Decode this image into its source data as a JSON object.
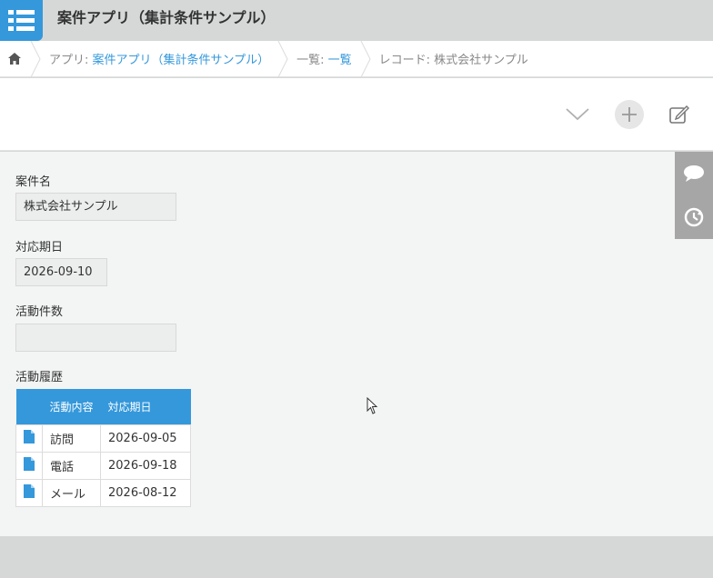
{
  "header": {
    "app_title": "案件アプリ（集計条件サンプル）"
  },
  "breadcrumb": {
    "app_prefix": "アプリ: ",
    "app_link": "案件アプリ（集計条件サンプル）",
    "list_prefix": "一覧: ",
    "list_link": "一覧",
    "record_label": "レコード: 株式会社サンプル"
  },
  "fields": {
    "case_name": {
      "label": "案件名",
      "value": "株式会社サンプル"
    },
    "due_date": {
      "label": "対応期日",
      "value": "2026-09-10"
    },
    "activity_count": {
      "label": "活動件数",
      "value": ""
    },
    "activity_history": {
      "label": "活動履歴"
    }
  },
  "subtable": {
    "headers": [
      "活動内容",
      "対応期日"
    ],
    "rows": [
      {
        "content": "訪問",
        "date": "2026-09-05"
      },
      {
        "content": "電話",
        "date": "2026-09-18"
      },
      {
        "content": "メール",
        "date": "2026-08-12"
      }
    ]
  },
  "colors": {
    "accent": "#3498db",
    "header_bg": "#d6d8d8",
    "content_bg": "#f3f4f4"
  }
}
